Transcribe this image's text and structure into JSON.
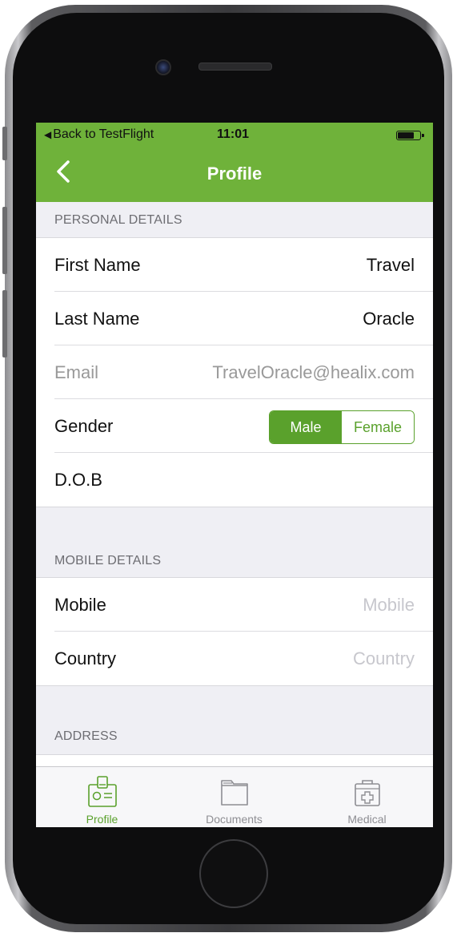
{
  "status_bar": {
    "back_app": "Back to TestFlight",
    "time": "11:01"
  },
  "nav": {
    "title": "Profile",
    "back_icon": "chevron-left-icon"
  },
  "sections": {
    "personal": {
      "header": "PERSONAL DETAILS",
      "first_name": {
        "label": "First Name",
        "value": "Travel"
      },
      "last_name": {
        "label": "Last Name",
        "value": "Oracle"
      },
      "email": {
        "label": "Email",
        "value": "TravelOracle@healix.com"
      },
      "gender": {
        "label": "Gender",
        "options": [
          "Male",
          "Female"
        ],
        "selected": "Male"
      },
      "dob": {
        "label": "D.O.B",
        "value": ""
      }
    },
    "mobile": {
      "header": "MOBILE DETAILS",
      "mobile": {
        "label": "Mobile",
        "placeholder": "Mobile"
      },
      "country": {
        "label": "Country",
        "placeholder": "Country"
      }
    },
    "address": {
      "header": "ADDRESS"
    }
  },
  "tabbar": {
    "tabs": [
      {
        "label": "Profile",
        "icon": "id-badge-icon",
        "active": true
      },
      {
        "label": "Documents",
        "icon": "folder-icon",
        "active": false
      },
      {
        "label": "Medical",
        "icon": "medical-kit-icon",
        "active": false
      }
    ]
  },
  "colors": {
    "accent": "#6fb23a",
    "segment": "#5aa12c",
    "background": "#efeff4"
  }
}
